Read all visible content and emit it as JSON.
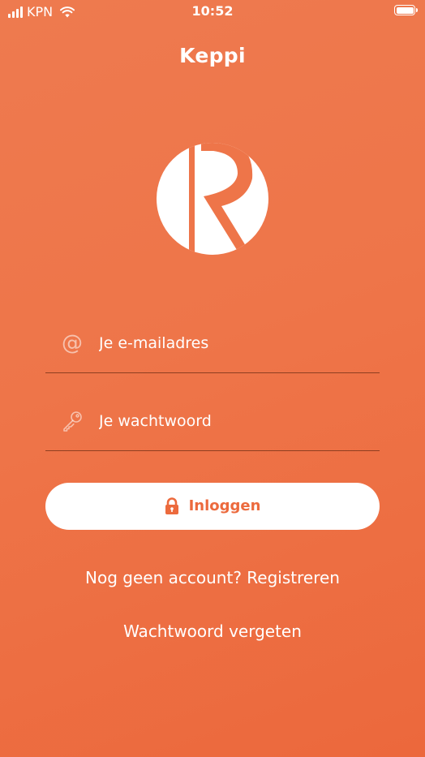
{
  "status_bar": {
    "carrier": "KPN",
    "time": "10:52",
    "icons": [
      "signal-icon",
      "wifi-icon",
      "battery-icon"
    ],
    "battery_level": 1.0
  },
  "header": {
    "title": "Keppi"
  },
  "logo": {
    "icon": "keppi-logo-icon"
  },
  "form": {
    "email": {
      "icon": "at-icon",
      "value": "",
      "placeholder": "Je e-mailadres"
    },
    "password": {
      "icon": "key-icon",
      "value": "",
      "placeholder": "Je wachtwoord"
    },
    "login_button": {
      "icon": "lock-icon",
      "label": "Inloggen"
    }
  },
  "links": {
    "register": "Nog geen account? Registreren",
    "forgot_password": "Wachtwoord vergeten"
  },
  "colors": {
    "background": "#ee7549",
    "accent": "#ec6a3d",
    "button_background": "#ffffff",
    "text": "#ffffff"
  }
}
